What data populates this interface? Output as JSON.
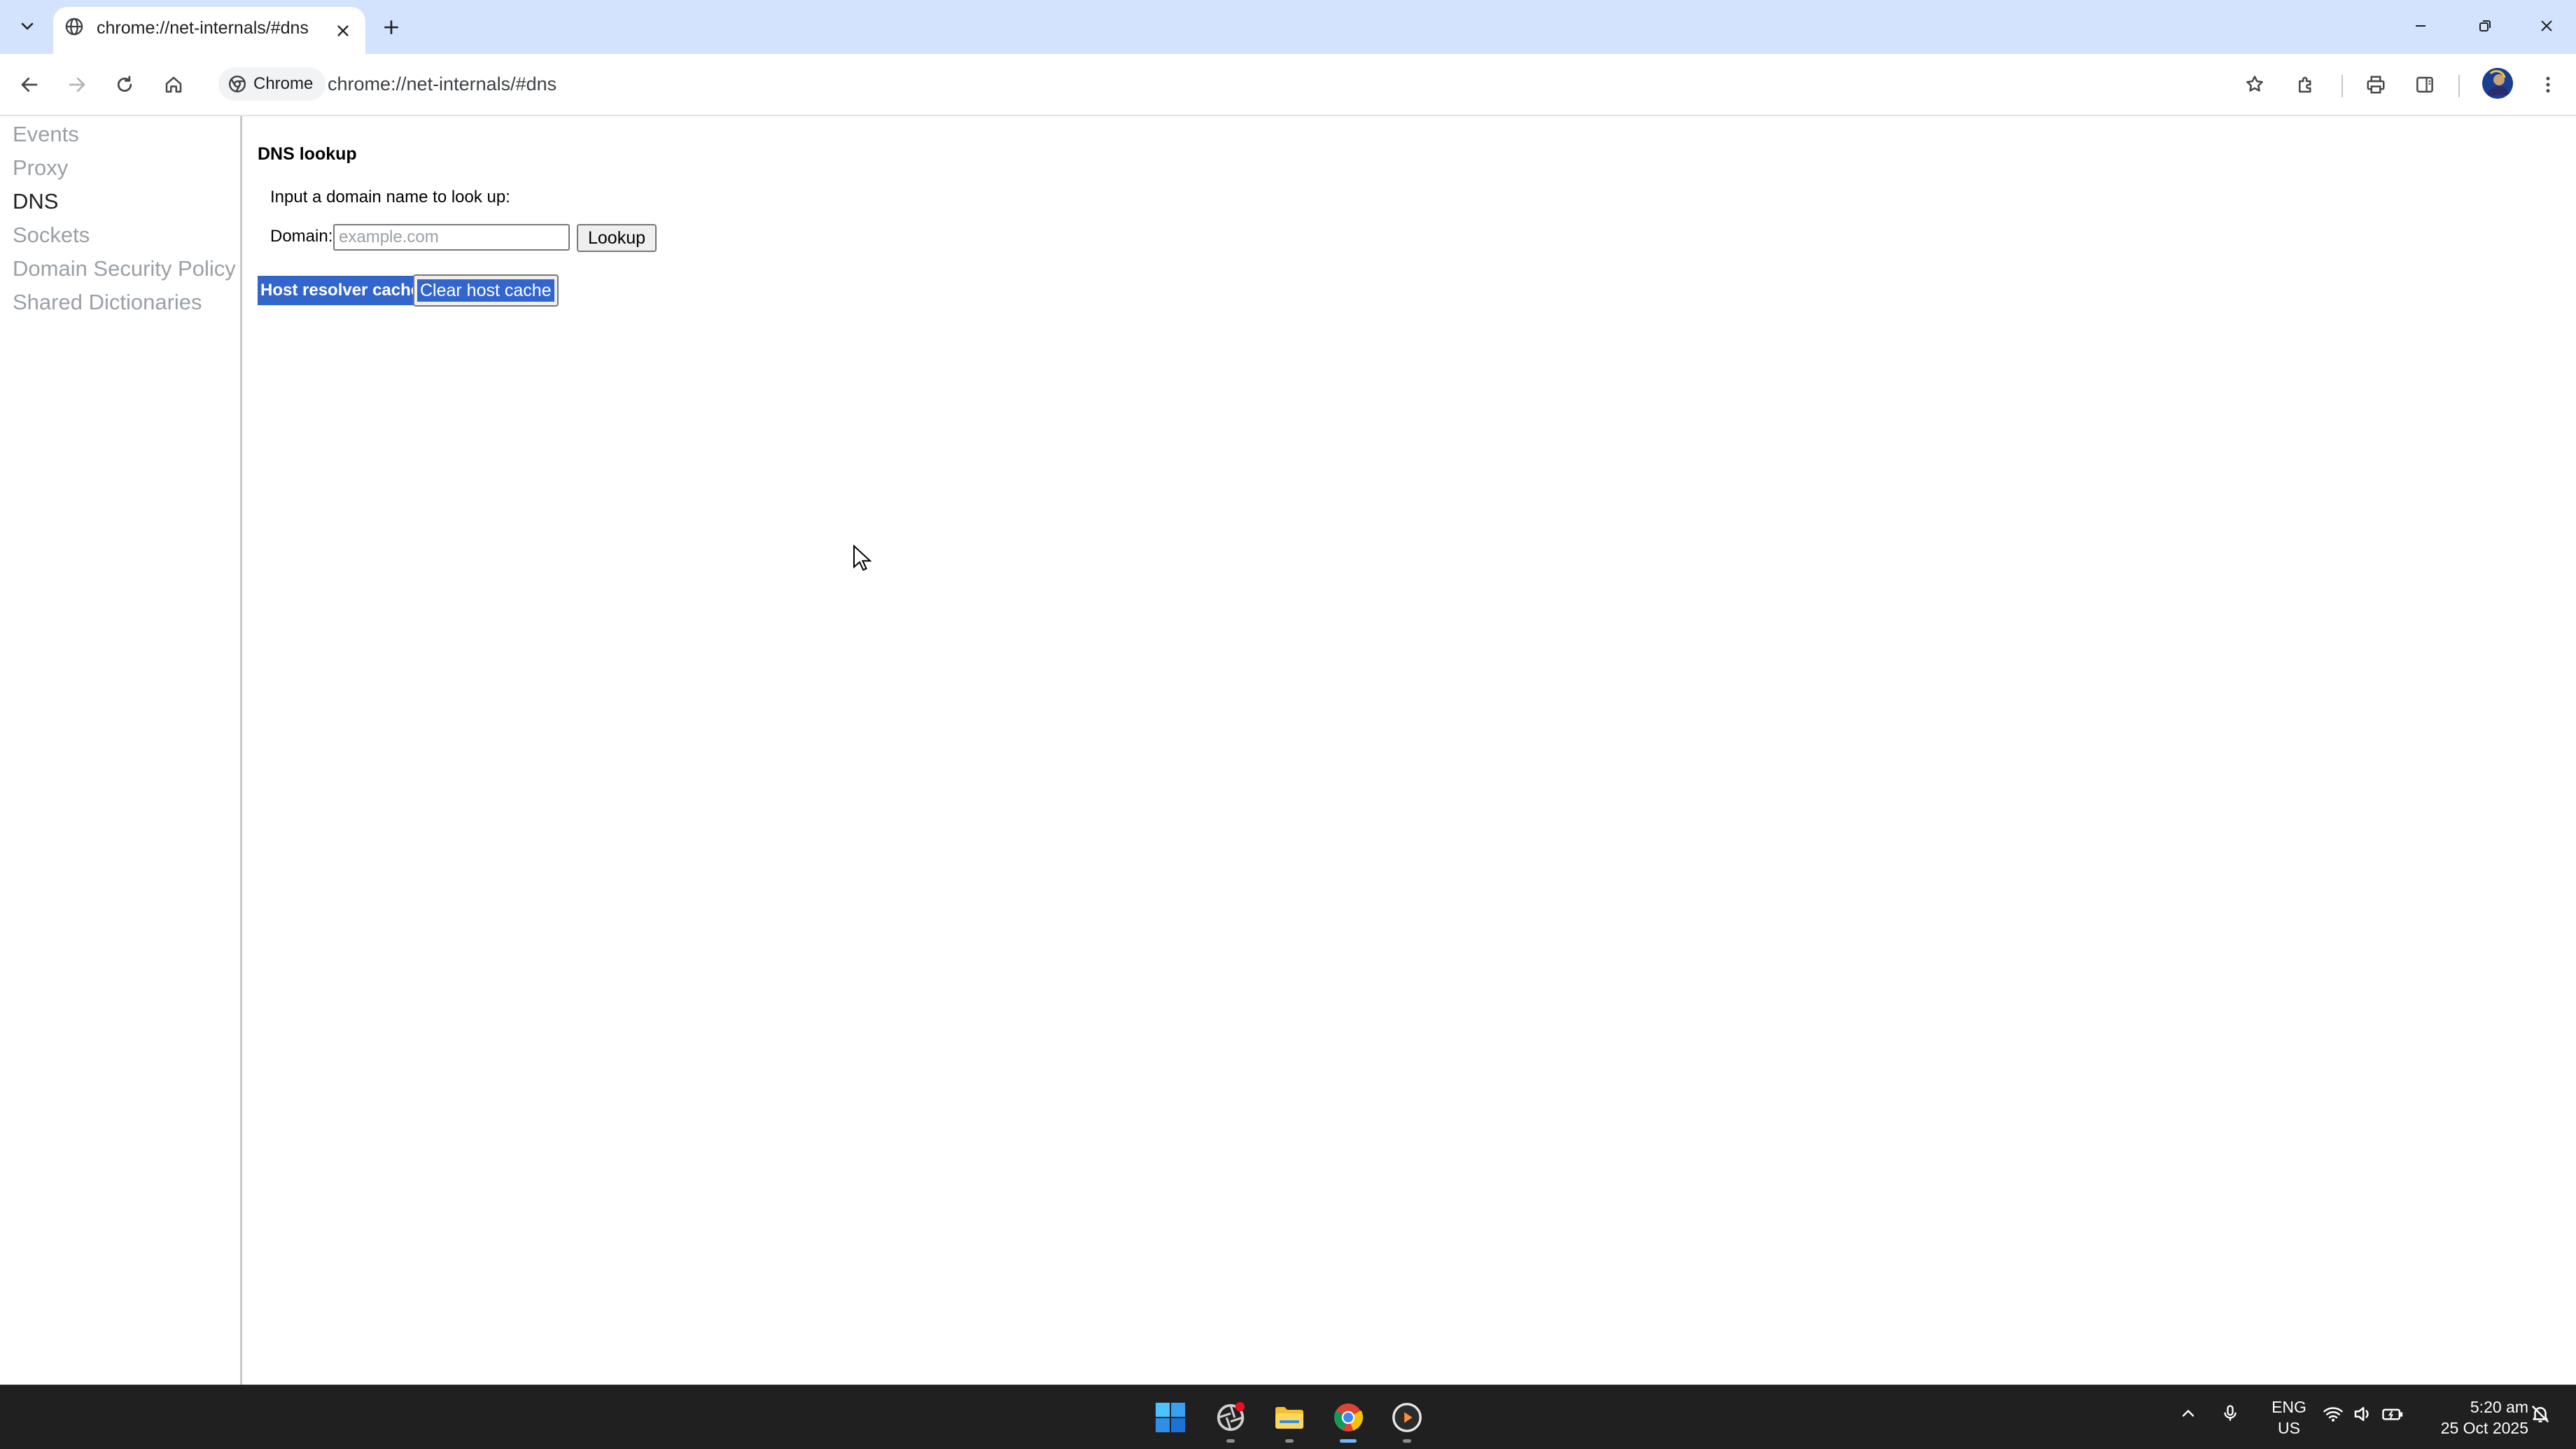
{
  "browser": {
    "tab": {
      "title": "chrome://net-internals/#dns"
    },
    "omnibox": {
      "chip_label": "Chrome",
      "url": "chrome://net-internals/#dns"
    }
  },
  "sidebar": {
    "items": [
      {
        "label": "Events",
        "active": false
      },
      {
        "label": "Proxy",
        "active": false
      },
      {
        "label": "DNS",
        "active": true
      },
      {
        "label": "Sockets",
        "active": false
      },
      {
        "label": "Domain Security Policy",
        "active": false
      },
      {
        "label": "Shared Dictionaries",
        "active": false
      }
    ]
  },
  "dns": {
    "title": "DNS lookup",
    "prompt": "Input a domain name to look up:",
    "domain_label": "Domain:",
    "domain_placeholder": "example.com",
    "domain_value": "",
    "lookup_button": "Lookup",
    "host_cache_title": "Host resolver cache",
    "clear_cache_button": "Clear host cache"
  },
  "taskbar": {
    "apps": [
      "windows-start",
      "app-with-badge",
      "file-explorer",
      "chrome",
      "media-player"
    ],
    "language": {
      "line1": "ENG",
      "line2": "US"
    },
    "clock": {
      "time": "5:20 am",
      "date": "25 Oct 2025"
    }
  },
  "colors": {
    "tab_strip": "#d3e3fd",
    "selection_highlight": "#3366cc",
    "taskbar": "#202020"
  }
}
